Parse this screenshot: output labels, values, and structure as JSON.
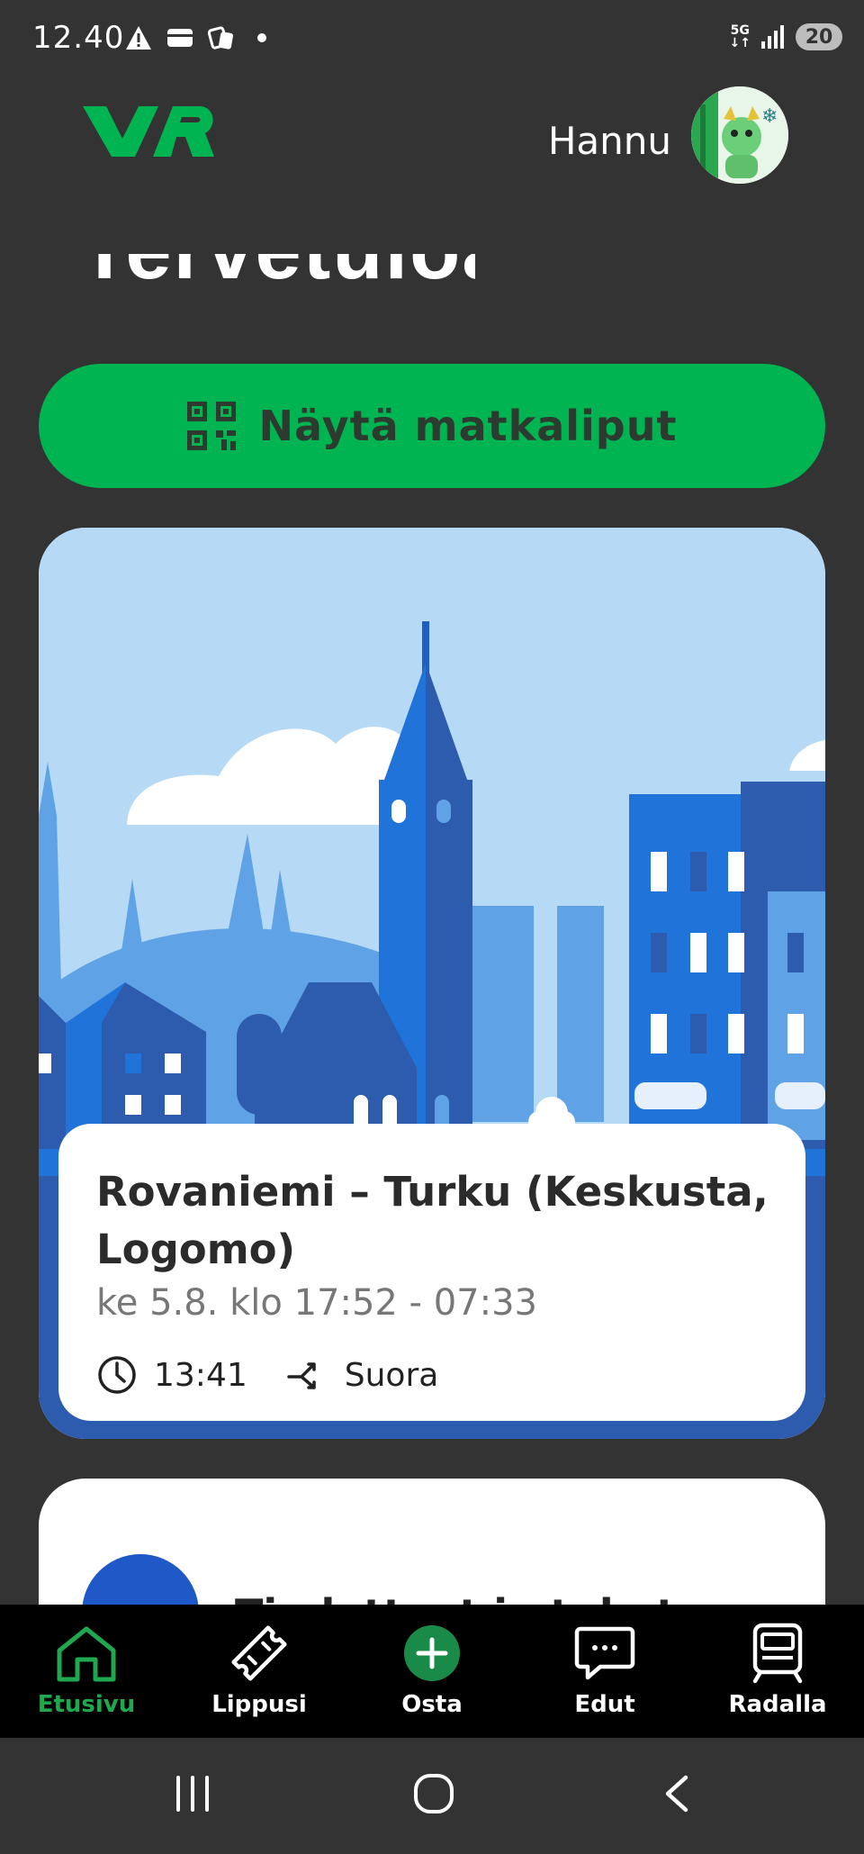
{
  "status_bar": {
    "time": "12.40",
    "network": "5G",
    "battery": "20"
  },
  "header": {
    "username": "Hannu",
    "page_title_partial": "Tervetuloa"
  },
  "tickets_button": {
    "label": "Näytä matkaliput"
  },
  "trip": {
    "route": "Rovaniemi – Turku (Keskusta, Logomo)",
    "dates": "ke 5.8. klo 17:52 - 07:33",
    "duration": "13:41",
    "connection": "Suora"
  },
  "next_card": {
    "label": "Tiedotteet ja tukut"
  },
  "nav": {
    "items": [
      {
        "label": "Etusivu",
        "icon": "home-icon",
        "active": true
      },
      {
        "label": "Lippusi",
        "icon": "ticket-icon",
        "active": false
      },
      {
        "label": "Osta",
        "icon": "plus-circle-icon",
        "active": false
      },
      {
        "label": "Edut",
        "icon": "chat-bubble-icon",
        "active": false
      },
      {
        "label": "Radalla",
        "icon": "train-icon",
        "active": false
      }
    ]
  },
  "colors": {
    "brand_green": "#00b451",
    "background": "#333333",
    "nav_active": "#1fa84f"
  }
}
